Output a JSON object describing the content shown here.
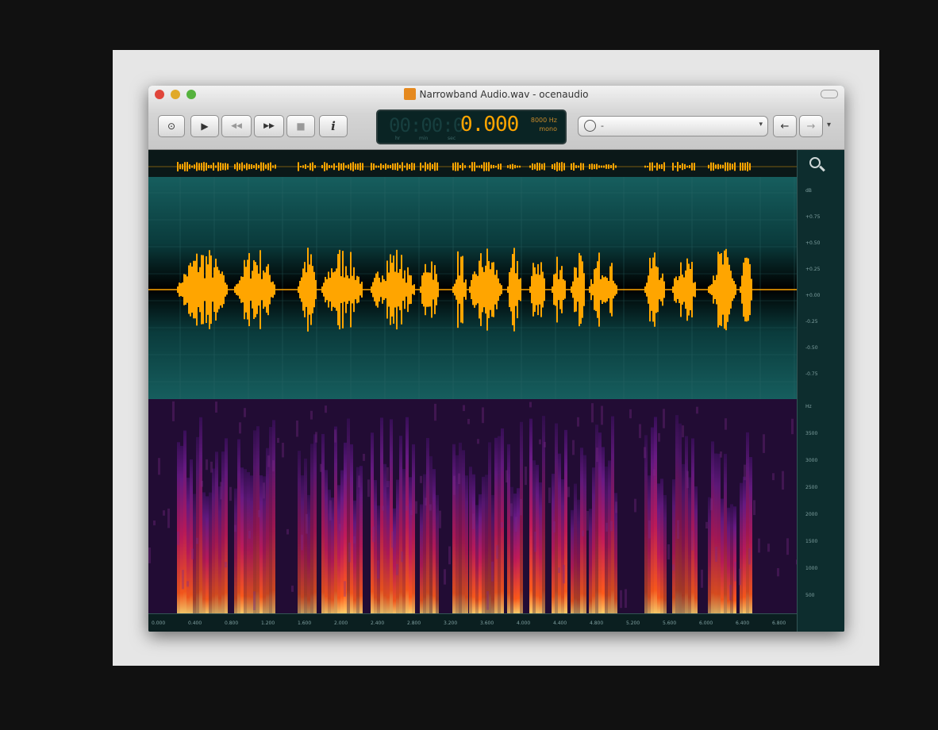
{
  "window": {
    "title": "Narrowband Audio.wav - ocenaudio",
    "app_icon": "audio-file-icon"
  },
  "toolbar": {
    "buttons": [
      {
        "icon": "record-icon",
        "label": "⊙"
      },
      {
        "icon": "play-icon",
        "label": "▶"
      },
      {
        "icon": "rewind-icon",
        "label": "◀◀"
      },
      {
        "icon": "fast-forward-icon",
        "label": "▶▶"
      },
      {
        "icon": "stop-icon",
        "label": "■"
      },
      {
        "icon": "info-icon",
        "label": "i"
      }
    ],
    "time_display": {
      "ghost": "00:00:0",
      "time": "0.000",
      "rate_line1": "8000 Hz",
      "rate_line2": "mono",
      "sub_labels": [
        "hr",
        "min",
        "sec"
      ]
    },
    "preset_select": {
      "value": "-",
      "icon": "clock-icon"
    },
    "nav": {
      "back": "←",
      "forward": "→",
      "more": "▾"
    }
  },
  "waveform": {
    "color": "#ffa500",
    "amp_ticks": [
      "dB",
      "+0.75",
      "+0.50",
      "+0.25",
      "+0.00",
      "-0.25",
      "-0.50",
      "-0.75"
    ]
  },
  "spectrogram": {
    "freq_ticks": [
      "Hz",
      "3500",
      "3000",
      "2500",
      "2000",
      "1500",
      "1000",
      "500"
    ]
  },
  "time_ruler": {
    "ticks": [
      "0.000",
      "0.400",
      "0.800",
      "1.200",
      "1.600",
      "2.000",
      "2.400",
      "2.800",
      "3.200",
      "3.600",
      "4.000",
      "4.400",
      "4.800",
      "5.200",
      "5.600",
      "6.000",
      "6.400",
      "6.800"
    ]
  },
  "colors": {
    "accent": "#ffa500",
    "waveform_bg": "#0d2b2c",
    "spectrogram_low": "#2a0a3c",
    "spectrogram_high": "#ff6a1a"
  }
}
